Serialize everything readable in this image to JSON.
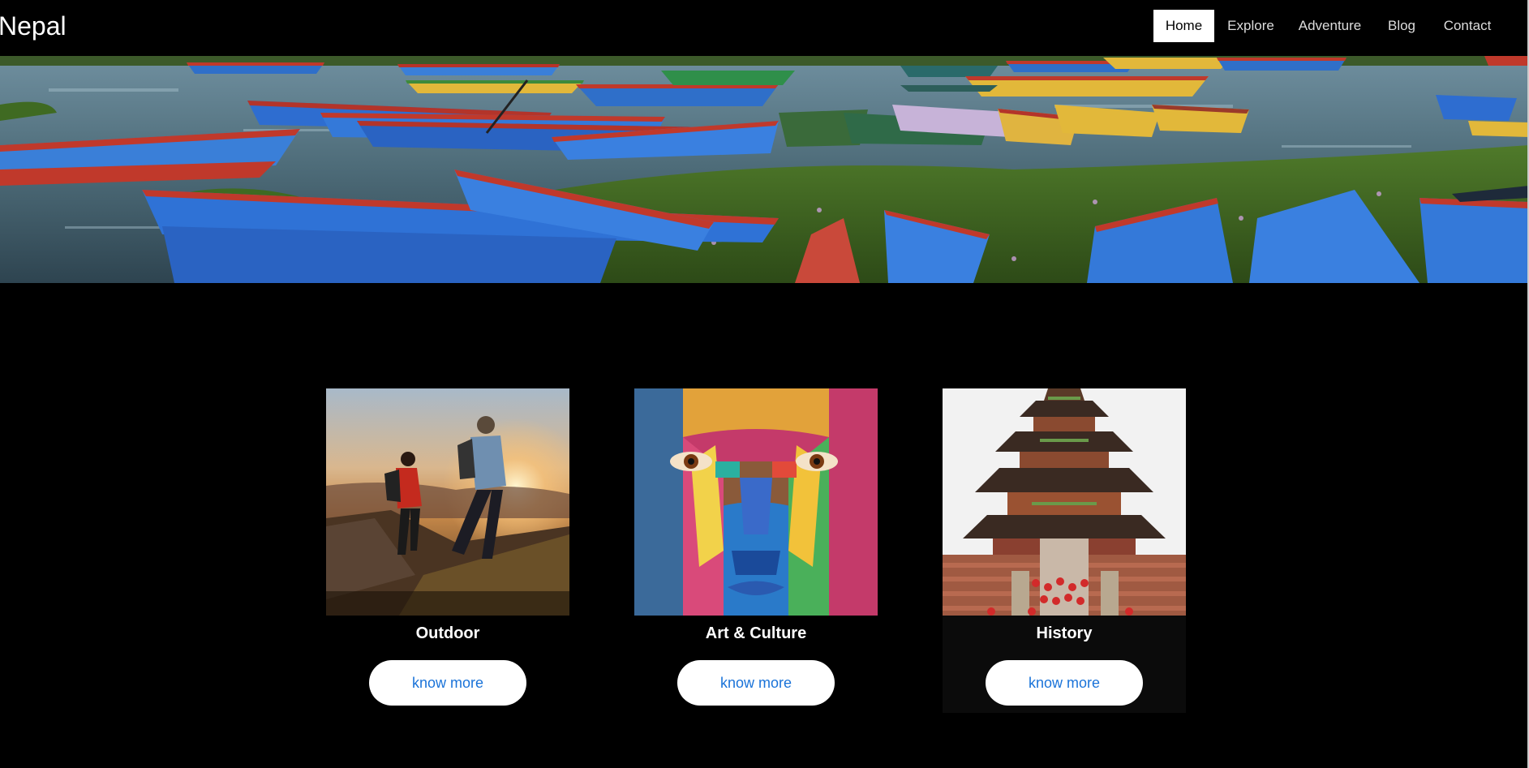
{
  "brand": {
    "title": "Nepal"
  },
  "nav": {
    "items": [
      {
        "label": "Home",
        "active": true
      },
      {
        "label": "Explore",
        "active": false
      },
      {
        "label": "Adventure",
        "active": false
      },
      {
        "label": "Blog",
        "active": false
      },
      {
        "label": "Contact",
        "active": false
      }
    ]
  },
  "cards": [
    {
      "title": "Outdoor",
      "button": "know more"
    },
    {
      "title": "Art & Culture",
      "button": "know more"
    },
    {
      "title": "History",
      "button": "know more"
    }
  ],
  "colors": {
    "background": "#000000",
    "button_text": "#1a73d9",
    "nav_active_bg": "#ffffff"
  }
}
